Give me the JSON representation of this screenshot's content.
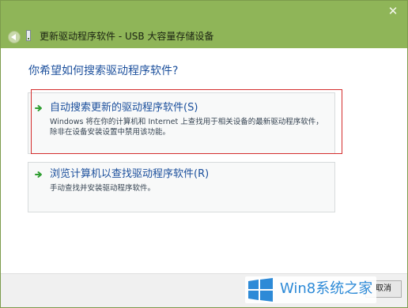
{
  "window": {
    "title": "更新驱动程序软件 - USB 大容量存储设备",
    "close_label": "✕"
  },
  "question": "你希望如何搜索驱动程序软件?",
  "options": [
    {
      "title": "自动搜索更新的驱动程序软件(S)",
      "description": "Windows 将在你的计算机和 Internet 上查找用于相关设备的最新驱动程序软件，除非在设备安装设置中禁用该功能。"
    },
    {
      "title": "浏览计算机以查找驱动程序软件(R)",
      "description": "手动查找并安装驱动程序软件。"
    }
  ],
  "footer": {
    "cancel_label": "取消"
  },
  "watermark": {
    "text": "Win8系统之家"
  },
  "icons": {
    "back": "back-arrow-icon",
    "device": "usb-device-icon",
    "option_arrow": "green-arrow-icon",
    "logo": "windows-logo-icon"
  },
  "colors": {
    "title_bar": "#8fb558",
    "link_blue": "#1b4f9c",
    "highlight_red": "#d42d2d",
    "arrow_green": "#2f9e31",
    "watermark_blue": "#2d8ad7"
  }
}
